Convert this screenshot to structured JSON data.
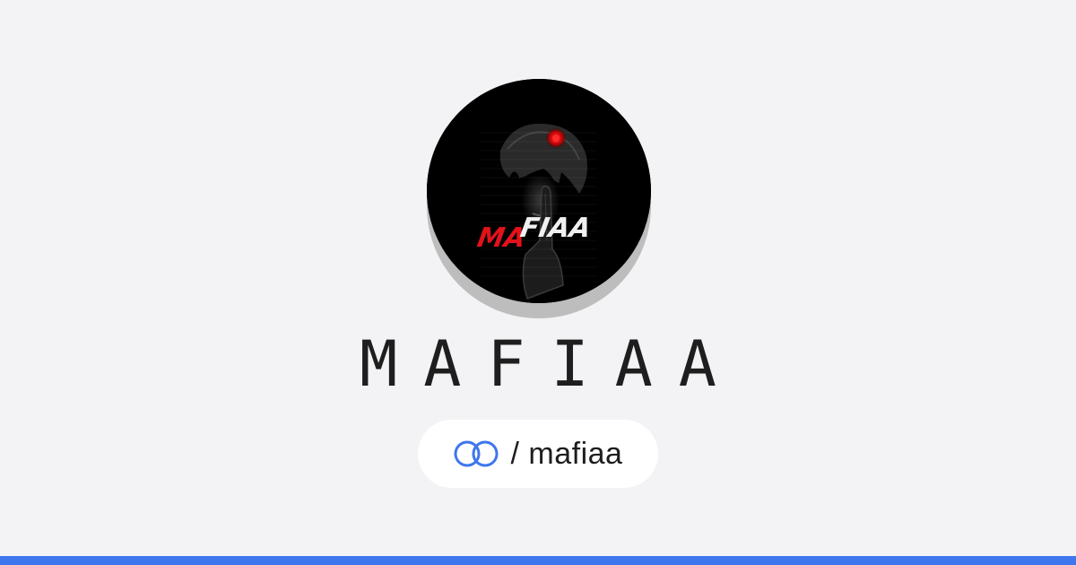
{
  "profile": {
    "name": "MAFIAA",
    "logo_text_red": "MA",
    "logo_text_white": "FIAA",
    "handle": "/ mafiaa"
  },
  "icons": {
    "link": "link-rings-icon"
  },
  "colors": {
    "background": "#f3f3f5",
    "accent_bar": "#3e76ee",
    "link_icon": "#3e76ee",
    "logo_red": "#e3121b",
    "title_text": "#1e1e1e"
  }
}
